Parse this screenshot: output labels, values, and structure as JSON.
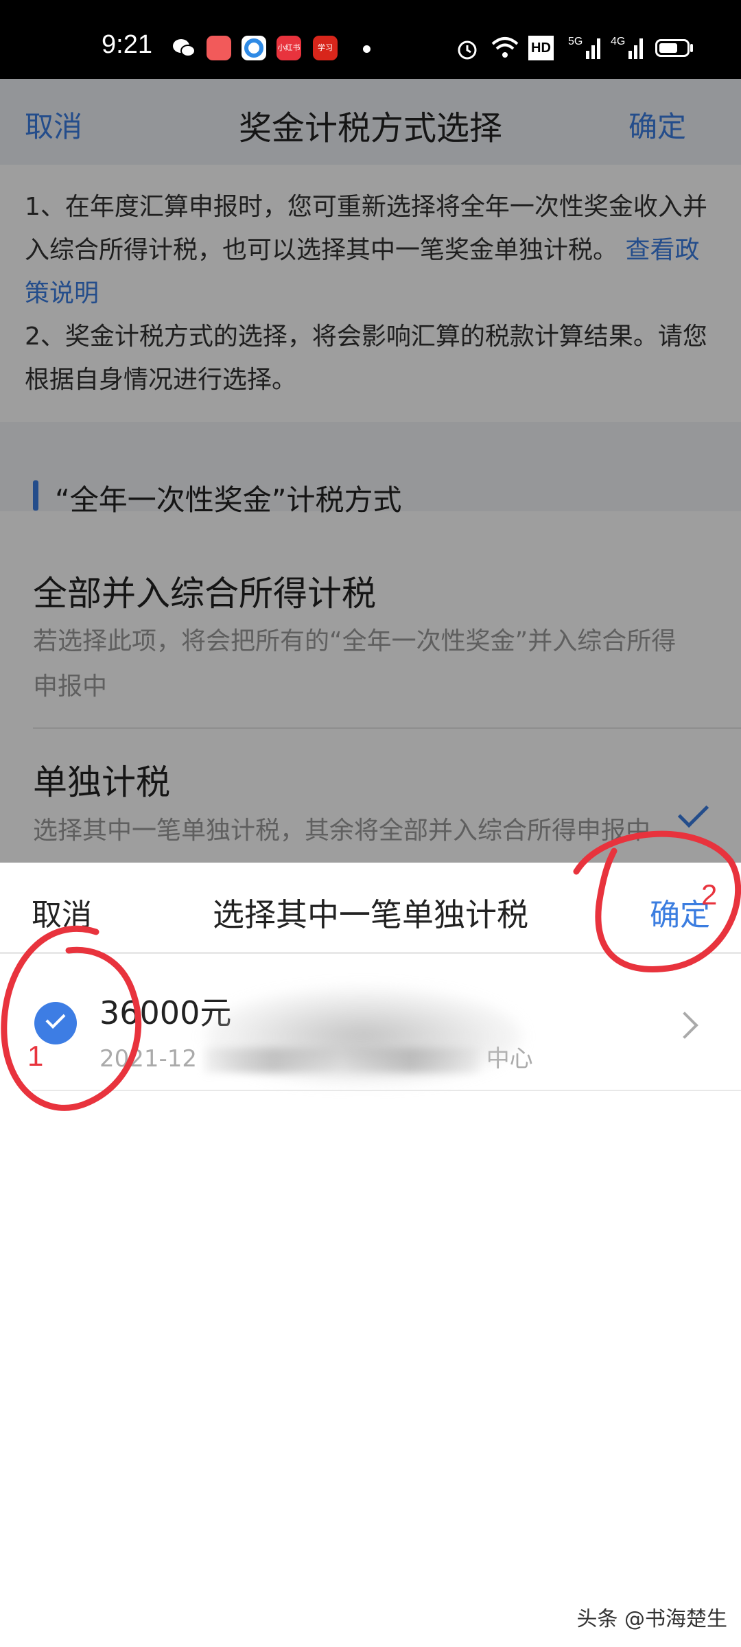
{
  "status_bar": {
    "time": "9:21",
    "network_labels": [
      "HD",
      "5G",
      "4G"
    ],
    "apps": [
      {
        "icon": "wechat-icon",
        "color": "#ffffff"
      },
      {
        "icon": "app-orange-icon",
        "color": "#f25a5a"
      },
      {
        "icon": "app-blue-ring-icon",
        "color": "#2f8ae5"
      },
      {
        "icon": "xiaohongshu-icon",
        "label": "小红书",
        "color": "#e8333d"
      },
      {
        "icon": "xuexi-icon",
        "label": "学习",
        "color": "#d8261b"
      }
    ]
  },
  "background_page": {
    "nav": {
      "cancel": "取消",
      "title": "奖金计税方式选择",
      "ok": "确定"
    },
    "notice": {
      "line1": "1、在年度汇算申报时，您可重新选择将全年一次性奖金收入并入综合所得计税，也可以选择其中一笔奖金单独计税。",
      "link": "查看政策说明",
      "line2": "2、奖金计税方式的选择，将会影响汇算的税款计算结果。请您根据自身情况进行选择。"
    },
    "section_title": "“全年一次性奖金”计税方式",
    "options": [
      {
        "title": "全部并入综合所得计税",
        "desc": "若选择此项，将会把所有的“全年一次性奖金”并入综合所得申报中"
      },
      {
        "title": "单独计税",
        "desc": "选择其中一笔单独计税，其余将全部并入综合所得申报中",
        "selected": true
      }
    ]
  },
  "sheet": {
    "cancel": "取消",
    "title": "选择其中一笔单独计税",
    "ok": "确定",
    "items": [
      {
        "amount": "36000元",
        "meta_prefix": "2021-12",
        "meta_suffix": "中心",
        "checked": true
      }
    ]
  },
  "annotations": {
    "step1": "1",
    "step2": "2",
    "color": "#e8333d"
  },
  "watermark": "头条 @书海楚生"
}
